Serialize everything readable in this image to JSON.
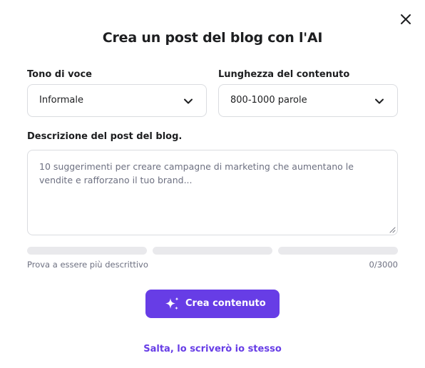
{
  "dialog": {
    "title": "Crea un post del blog con l'AI"
  },
  "tone": {
    "label": "Tono di voce",
    "selected": "Informale"
  },
  "length": {
    "label": "Lunghezza del contenuto",
    "selected": "800-1000 parole"
  },
  "description": {
    "label": "Descrizione del post del blog.",
    "placeholder": "10 suggerimenti per creare campagne di marketing che aumentano le vendite e rafforzano il tuo brand...",
    "value": ""
  },
  "strength": {
    "segments": [
      0,
      0,
      0
    ],
    "hint": "Prova a essere più descrittivo",
    "counter": "0/3000"
  },
  "actions": {
    "create_label": "Crea contenuto",
    "skip_label": "Salta, lo scriverò io stesso"
  },
  "icons": {
    "close": "close-icon",
    "chevron": "chevron-down-icon",
    "sparkle": "sparkle-icon"
  },
  "colors": {
    "accent": "#673de6",
    "text": "#1d1e20",
    "muted": "#6d7081",
    "border": "#dadce0",
    "track": "#e9e9ec"
  }
}
